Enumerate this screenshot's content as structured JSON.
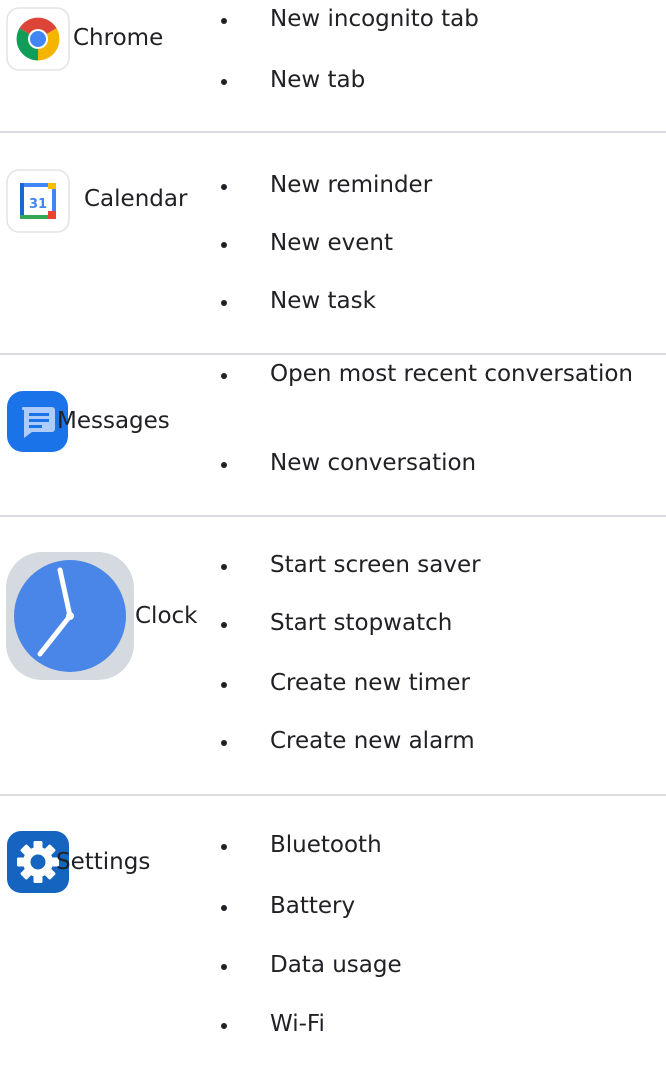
{
  "rows": [
    {
      "app": "Chrome",
      "icon": "chrome-icon",
      "actions": [
        "New incognito tab",
        "New tab"
      ]
    },
    {
      "app": "Calendar",
      "icon": "calendar-icon",
      "icon_text": "31",
      "actions": [
        "New reminder",
        "New event",
        "New task"
      ]
    },
    {
      "app": "Messages",
      "icon": "messages-icon",
      "actions": [
        "Open most recent conversation",
        "New conversation"
      ]
    },
    {
      "app": "Clock",
      "icon": "clock-icon",
      "actions": [
        "Start screen saver",
        "Start stopwatch",
        "Create new timer",
        "Create new alarm"
      ]
    },
    {
      "app": "Settings",
      "icon": "settings-icon",
      "actions": [
        "Bluetooth",
        "Battery",
        "Data usage",
        "Wi-Fi"
      ]
    }
  ],
  "colors": {
    "divider": "#dadce0",
    "text": "#202124",
    "chrome_red": "#db4437",
    "chrome_yellow": "#f4b400",
    "chrome_green": "#0f9d58",
    "chrome_blue": "#4285f4",
    "calendar_blue": "#4285f4",
    "messages_blue": "#1a73e8",
    "clock_face": "#4a86e8",
    "clock_rim": "#d5dae0",
    "settings_blue": "#1565c0"
  }
}
